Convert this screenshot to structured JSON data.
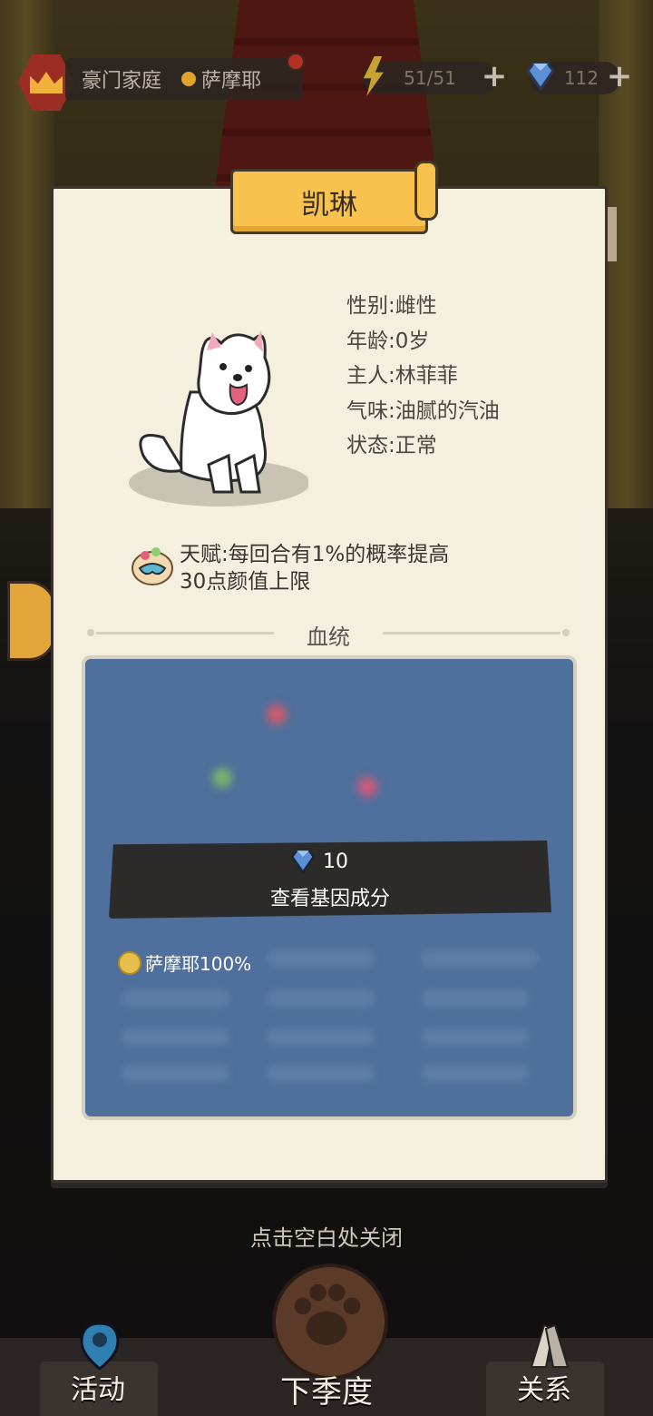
{
  "topbar": {
    "family_type": "豪门家庭",
    "breed": "萨摩耶",
    "energy": "51/51",
    "gems": "112"
  },
  "dialog": {
    "name": "凯琳",
    "info": [
      "性别:雌性",
      "年龄:0岁",
      "主人:林菲菲",
      "气味:油腻的汽油",
      "状态:正常"
    ],
    "talent_line1": "天赋:每回合有1%的概率提高",
    "talent_line2": "30点颜值上限",
    "bloodline_title": "血统",
    "reveal_cost": "10",
    "reveal_label": "查看基因成分",
    "breed_percent": "萨摩耶100%"
  },
  "close_hint": "点击空白处关闭",
  "bottom_nav": {
    "activity": "活动",
    "next_season": "下季度",
    "relations": "关系"
  }
}
